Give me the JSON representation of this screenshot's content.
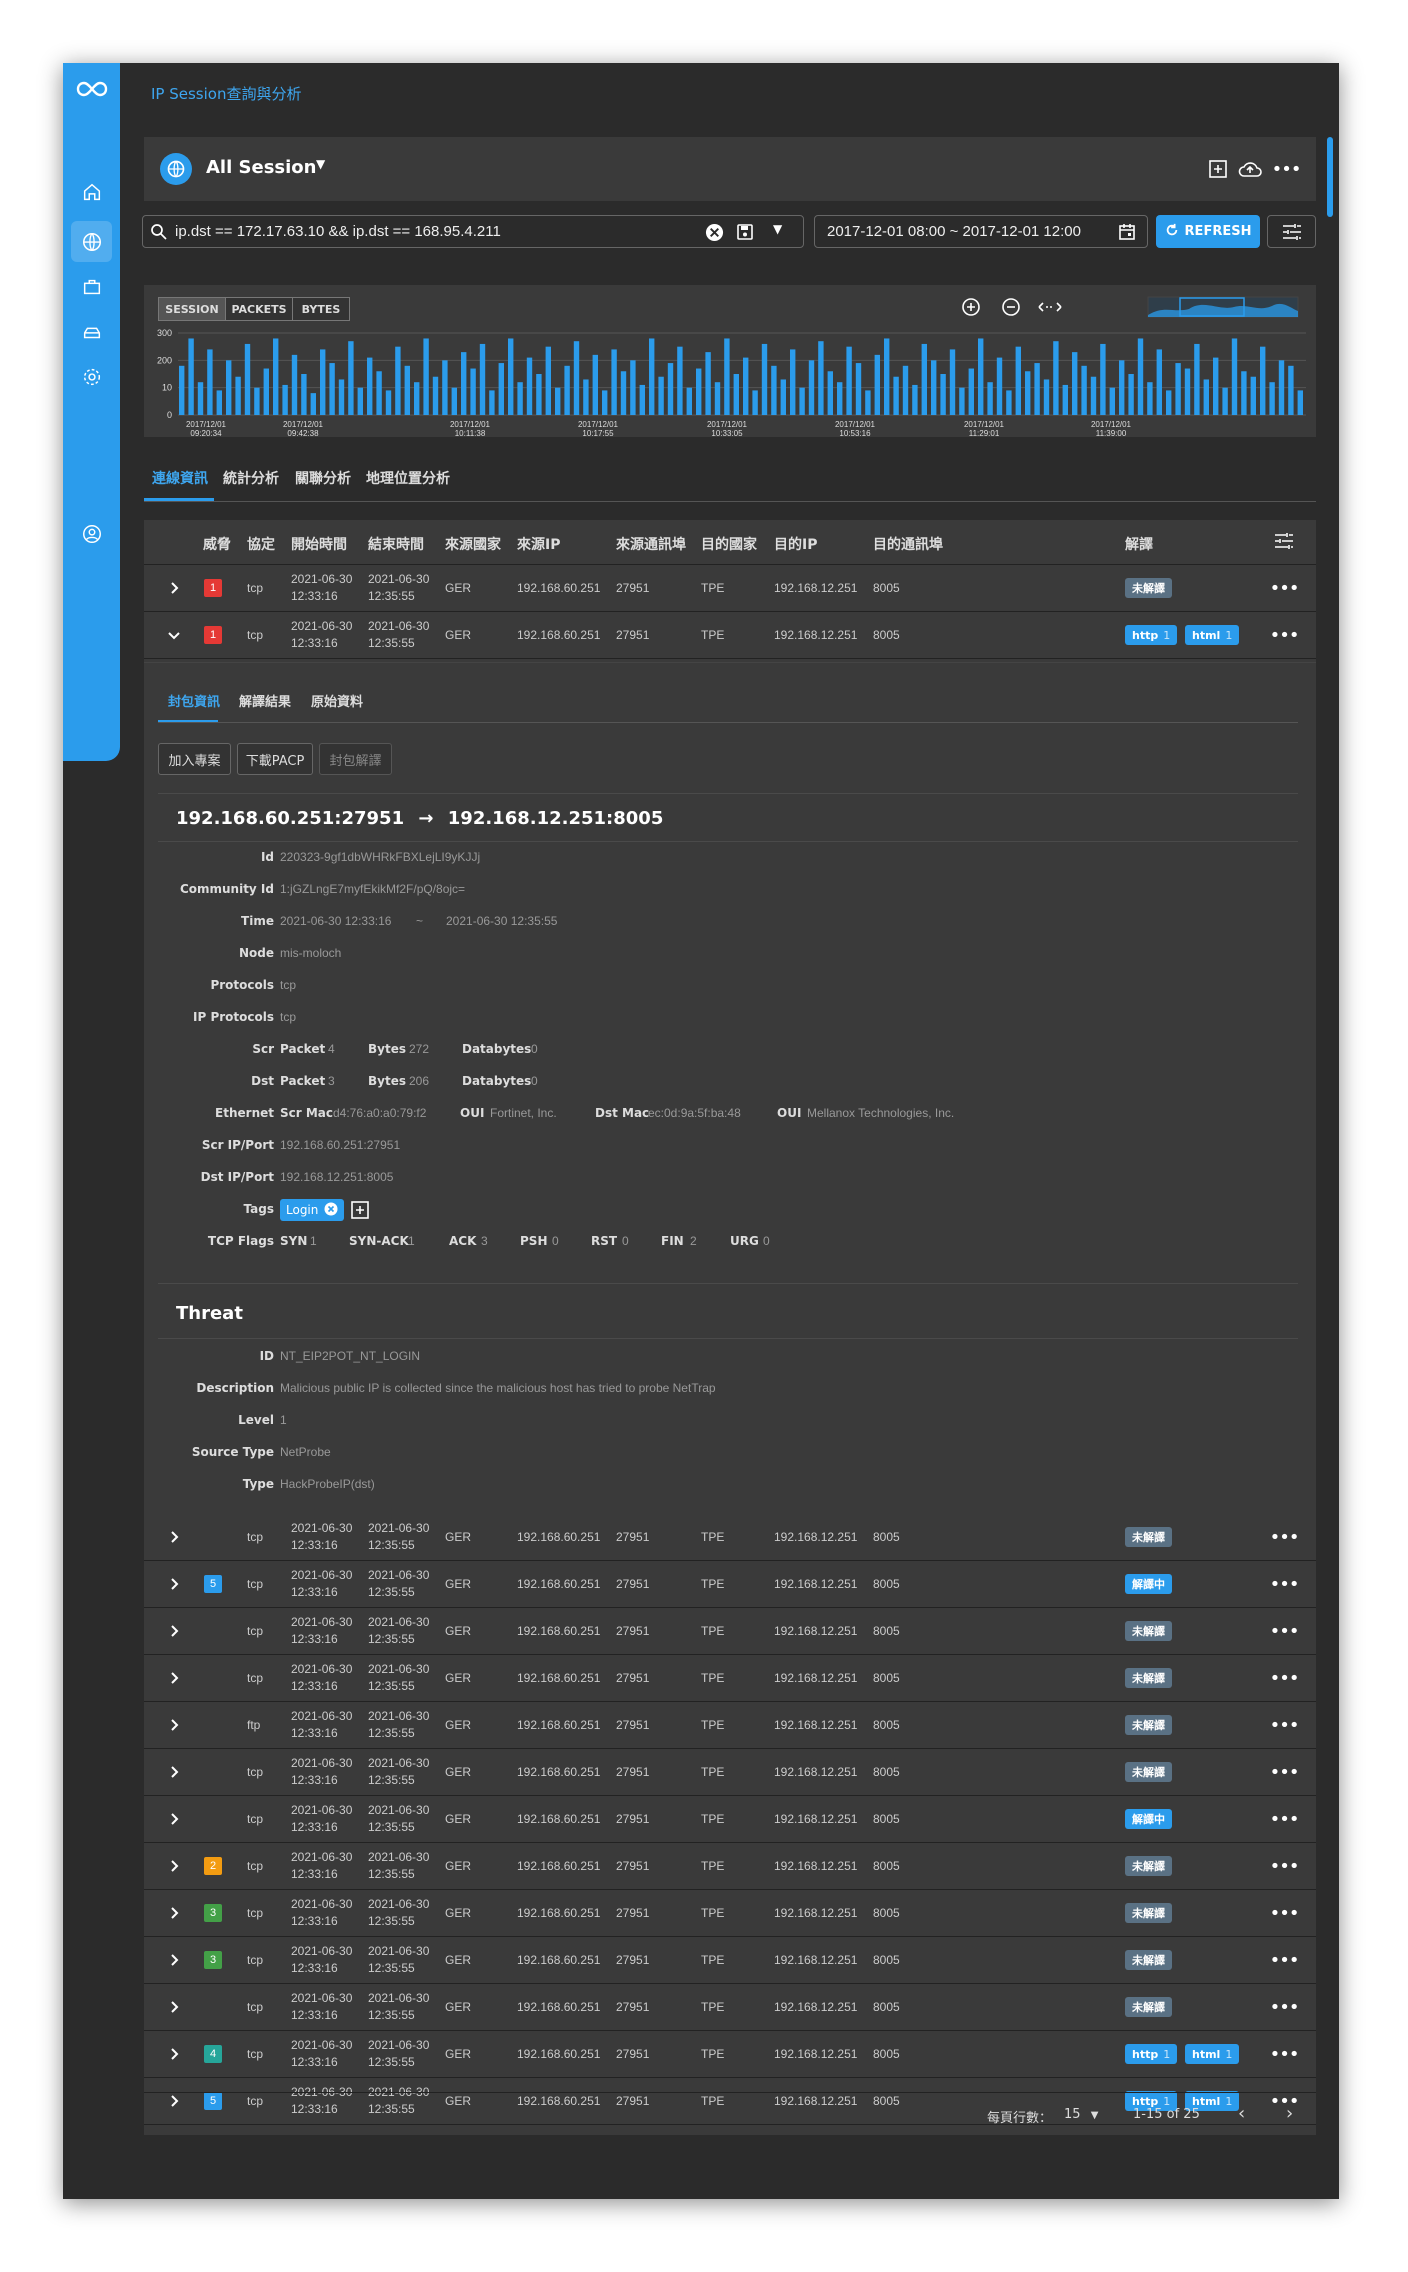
{
  "breadcrumb": "IP Session查詢與分析",
  "toolbar": {
    "title": "All Session"
  },
  "search": {
    "query": "ip.dst == 172.17.63.10 && ip.dst == 168.95.4.211"
  },
  "daterange": {
    "value": "2017-12-01 08:00 ~ 2017-12-01 12:00"
  },
  "refresh_label": "REFRESH",
  "chart_data": {
    "type": "bar",
    "toggles": [
      "SESSION",
      "PACKETS",
      "BYTES"
    ],
    "active_toggle": "SESSION",
    "yticks": [
      "300",
      "200",
      "10",
      "0"
    ],
    "xticks": [
      {
        "date": "2017/12/01",
        "time": "09:20:34"
      },
      {
        "date": "2017/12/01",
        "time": "09:42:38"
      },
      {
        "date": "2017/12/01",
        "time": "10:11:38"
      },
      {
        "date": "2017/12/01",
        "time": "10:17:55"
      },
      {
        "date": "2017/12/01",
        "time": "10:33:05"
      },
      {
        "date": "2017/12/01",
        "time": "10:53:16"
      },
      {
        "date": "2017/12/01",
        "time": "11:29:01"
      },
      {
        "date": "2017/12/01",
        "time": "11:39:00"
      }
    ],
    "values": [
      180,
      280,
      120,
      240,
      90,
      200,
      140,
      260,
      100,
      170,
      280,
      110,
      220,
      150,
      80,
      240,
      190,
      130,
      270,
      100,
      210,
      160,
      90,
      250,
      180,
      120,
      280,
      140,
      200,
      100,
      230,
      170,
      260,
      90,
      190,
      280,
      120,
      210,
      150,
      250,
      100,
      180,
      270,
      130,
      220,
      90,
      240,
      160,
      200,
      110,
      280,
      140,
      190,
      250,
      100,
      170,
      230,
      120,
      280,
      150,
      210,
      90,
      260,
      180,
      130,
      240,
      100,
      200,
      270,
      160,
      120,
      250,
      190,
      90,
      220,
      280,
      140,
      180,
      110,
      260,
      200,
      150,
      240,
      100,
      170,
      280,
      120,
      210,
      90,
      250,
      160,
      190,
      130,
      270,
      110,
      230,
      180,
      140,
      260,
      100,
      200,
      150,
      280,
      120,
      240,
      90,
      190,
      170,
      260,
      130,
      210,
      100,
      280,
      160,
      140,
      250,
      120,
      200,
      180,
      90
    ]
  },
  "tabs": [
    "連線資訊",
    "統計分析",
    "關聯分析",
    "地理位置分析"
  ],
  "columns": [
    "威脅",
    "協定",
    "開始時間",
    "結束時間",
    "來源國家",
    "來源IP",
    "來源通訊埠",
    "目的國家",
    "目的IP",
    "目的通訊埠",
    "解譯"
  ],
  "rows": [
    {
      "threat": "1",
      "threat_color": "#e53935",
      "proto": "tcp",
      "start_date": "2021-06-30",
      "start_time": "12:33:16",
      "end_date": "2021-06-30",
      "end_time": "12:35:55",
      "src_country": "GER",
      "src_ip": "192.168.60.251",
      "src_port": "27951",
      "dst_country": "TPE",
      "dst_ip": "192.168.12.251",
      "dst_port": "8005",
      "badges": [
        {
          "label": "未解譯",
          "type": "gray"
        }
      ]
    },
    {
      "threat": "1",
      "threat_color": "#e53935",
      "proto": "tcp",
      "start_date": "2021-06-30",
      "start_time": "12:33:16",
      "end_date": "2021-06-30",
      "end_time": "12:35:55",
      "src_country": "GER",
      "src_ip": "192.168.60.251",
      "src_port": "27951",
      "dst_country": "TPE",
      "dst_ip": "192.168.12.251",
      "dst_port": "8005",
      "badges": [
        {
          "label": "http",
          "count": "1",
          "type": "blue"
        },
        {
          "label": "html",
          "count": "1",
          "type": "blue"
        }
      ]
    },
    {
      "threat": "",
      "threat_color": "",
      "proto": "tcp",
      "start_date": "2021-06-30",
      "start_time": "12:33:16",
      "end_date": "2021-06-30",
      "end_time": "12:35:55",
      "src_country": "GER",
      "src_ip": "192.168.60.251",
      "src_port": "27951",
      "dst_country": "TPE",
      "dst_ip": "192.168.12.251",
      "dst_port": "8005",
      "badges": [
        {
          "label": "未解譯",
          "type": "gray"
        }
      ]
    },
    {
      "threat": "5",
      "threat_color": "#2b9cec",
      "proto": "tcp",
      "start_date": "2021-06-30",
      "start_time": "12:33:16",
      "end_date": "2021-06-30",
      "end_time": "12:35:55",
      "src_country": "GER",
      "src_ip": "192.168.60.251",
      "src_port": "27951",
      "dst_country": "TPE",
      "dst_ip": "192.168.12.251",
      "dst_port": "8005",
      "badges": [
        {
          "label": "解譯中",
          "type": "blue"
        }
      ]
    },
    {
      "threat": "",
      "threat_color": "",
      "proto": "tcp",
      "start_date": "2021-06-30",
      "start_time": "12:33:16",
      "end_date": "2021-06-30",
      "end_time": "12:35:55",
      "src_country": "GER",
      "src_ip": "192.168.60.251",
      "src_port": "27951",
      "dst_country": "TPE",
      "dst_ip": "192.168.12.251",
      "dst_port": "8005",
      "badges": [
        {
          "label": "未解譯",
          "type": "gray"
        }
      ]
    },
    {
      "threat": "",
      "threat_color": "",
      "proto": "tcp",
      "start_date": "2021-06-30",
      "start_time": "12:33:16",
      "end_date": "2021-06-30",
      "end_time": "12:35:55",
      "src_country": "GER",
      "src_ip": "192.168.60.251",
      "src_port": "27951",
      "dst_country": "TPE",
      "dst_ip": "192.168.12.251",
      "dst_port": "8005",
      "badges": [
        {
          "label": "未解譯",
          "type": "gray"
        }
      ]
    },
    {
      "threat": "",
      "threat_color": "",
      "proto": "ftp",
      "start_date": "2021-06-30",
      "start_time": "12:33:16",
      "end_date": "2021-06-30",
      "end_time": "12:35:55",
      "src_country": "GER",
      "src_ip": "192.168.60.251",
      "src_port": "27951",
      "dst_country": "TPE",
      "dst_ip": "192.168.12.251",
      "dst_port": "8005",
      "badges": [
        {
          "label": "未解譯",
          "type": "gray"
        }
      ]
    },
    {
      "threat": "",
      "threat_color": "",
      "proto": "tcp",
      "start_date": "2021-06-30",
      "start_time": "12:33:16",
      "end_date": "2021-06-30",
      "end_time": "12:35:55",
      "src_country": "GER",
      "src_ip": "192.168.60.251",
      "src_port": "27951",
      "dst_country": "TPE",
      "dst_ip": "192.168.12.251",
      "dst_port": "8005",
      "badges": [
        {
          "label": "未解譯",
          "type": "gray"
        }
      ]
    },
    {
      "threat": "",
      "threat_color": "",
      "proto": "tcp",
      "start_date": "2021-06-30",
      "start_time": "12:33:16",
      "end_date": "2021-06-30",
      "end_time": "12:35:55",
      "src_country": "GER",
      "src_ip": "192.168.60.251",
      "src_port": "27951",
      "dst_country": "TPE",
      "dst_ip": "192.168.12.251",
      "dst_port": "8005",
      "badges": [
        {
          "label": "解譯中",
          "type": "blue"
        }
      ]
    },
    {
      "threat": "2",
      "threat_color": "#f39c12",
      "proto": "tcp",
      "start_date": "2021-06-30",
      "start_time": "12:33:16",
      "end_date": "2021-06-30",
      "end_time": "12:35:55",
      "src_country": "GER",
      "src_ip": "192.168.60.251",
      "src_port": "27951",
      "dst_country": "TPE",
      "dst_ip": "192.168.12.251",
      "dst_port": "8005",
      "badges": [
        {
          "label": "未解譯",
          "type": "gray"
        }
      ]
    },
    {
      "threat": "3",
      "threat_color": "#43a047",
      "proto": "tcp",
      "start_date": "2021-06-30",
      "start_time": "12:33:16",
      "end_date": "2021-06-30",
      "end_time": "12:35:55",
      "src_country": "GER",
      "src_ip": "192.168.60.251",
      "src_port": "27951",
      "dst_country": "TPE",
      "dst_ip": "192.168.12.251",
      "dst_port": "8005",
      "badges": [
        {
          "label": "未解譯",
          "type": "gray"
        }
      ]
    },
    {
      "threat": "3",
      "threat_color": "#43a047",
      "proto": "tcp",
      "start_date": "2021-06-30",
      "start_time": "12:33:16",
      "end_date": "2021-06-30",
      "end_time": "12:35:55",
      "src_country": "GER",
      "src_ip": "192.168.60.251",
      "src_port": "27951",
      "dst_country": "TPE",
      "dst_ip": "192.168.12.251",
      "dst_port": "8005",
      "badges": [
        {
          "label": "未解譯",
          "type": "gray"
        }
      ]
    },
    {
      "threat": "",
      "threat_color": "",
      "proto": "tcp",
      "start_date": "2021-06-30",
      "start_time": "12:33:16",
      "end_date": "2021-06-30",
      "end_time": "12:35:55",
      "src_country": "GER",
      "src_ip": "192.168.60.251",
      "src_port": "27951",
      "dst_country": "TPE",
      "dst_ip": "192.168.12.251",
      "dst_port": "8005",
      "badges": [
        {
          "label": "未解譯",
          "type": "gray"
        }
      ]
    },
    {
      "threat": "4",
      "threat_color": "#26a69a",
      "proto": "tcp",
      "start_date": "2021-06-30",
      "start_time": "12:33:16",
      "end_date": "2021-06-30",
      "end_time": "12:35:55",
      "src_country": "GER",
      "src_ip": "192.168.60.251",
      "src_port": "27951",
      "dst_country": "TPE",
      "dst_ip": "192.168.12.251",
      "dst_port": "8005",
      "badges": [
        {
          "label": "http",
          "count": "1",
          "type": "blue"
        },
        {
          "label": "html",
          "count": "1",
          "type": "blue"
        }
      ]
    },
    {
      "threat": "5",
      "threat_color": "#2b9cec",
      "proto": "tcp",
      "start_date": "2021-06-30",
      "start_time": "12:33:16",
      "end_date": "2021-06-30",
      "end_time": "12:35:55",
      "src_country": "GER",
      "src_ip": "192.168.60.251",
      "src_port": "27951",
      "dst_country": "TPE",
      "dst_ip": "192.168.12.251",
      "dst_port": "8005",
      "badges": [
        {
          "label": "http",
          "count": "1",
          "type": "blue"
        },
        {
          "label": "html",
          "count": "1",
          "type": "blue"
        }
      ]
    }
  ],
  "detail": {
    "tabs": [
      "封包資訊",
      "解譯結果",
      "原始資料"
    ],
    "actions": [
      "加入專案",
      "下載PACP",
      "封包解譯"
    ],
    "flow_src": "192.168.60.251:27951",
    "flow_arrow": "→",
    "flow_dst": "192.168.12.251:8005",
    "id_label": "Id",
    "id": "220323-9gf1dbWHRkFBXLejLI9yKJJj",
    "community_label": "Community Id",
    "community_id": "1:jGZLngE7myfEkikMf2F/pQ/8ojc=",
    "time_label": "Time",
    "time_start": "2021-06-30 12:33:16",
    "time_sep": "~",
    "time_end": "2021-06-30 12:35:55",
    "node_label": "Node",
    "node": "mis-moloch",
    "protocols_label": "Protocols",
    "protocols": "tcp",
    "ip_protocols_label": "IP Protocols",
    "ip_protocols": "tcp",
    "scr_label": "Scr",
    "dst_label": "Dst",
    "packet_label": "Packet",
    "bytes_label": "Bytes",
    "databytes_label": "Databytes",
    "scr_packet": "4",
    "scr_bytes": "272",
    "scr_databytes": "0",
    "dst_packet": "3",
    "dst_bytes": "206",
    "dst_databytes": "0",
    "ethernet_label": "Ethernet",
    "scr_mac_label": "Scr Mac",
    "scr_mac": "d4:76:a0:a0:79:f2",
    "oui_label": "OUI",
    "scr_oui": "Fortinet, Inc.",
    "dst_mac_label": "Dst Mac",
    "dst_mac": "ec:0d:9a:5f:ba:48",
    "dst_oui": "Mellanox Technologies, Inc.",
    "scr_ipport_label": "Scr IP/Port",
    "scr_ipport": "192.168.60.251:27951",
    "dst_ipport_label": "Dst IP/Port",
    "dst_ipport": "192.168.12.251:8005",
    "tags_label": "Tags",
    "tag": "Login",
    "tcp_flags_label": "TCP Flags",
    "flags": [
      {
        "name": "SYN",
        "value": "1"
      },
      {
        "name": "SYN-ACK",
        "value": "1"
      },
      {
        "name": "ACK",
        "value": "3"
      },
      {
        "name": "PSH",
        "value": "0"
      },
      {
        "name": "RST",
        "value": "0"
      },
      {
        "name": "FIN",
        "value": "2"
      },
      {
        "name": "URG",
        "value": "0"
      }
    ],
    "threat_title": "Threat",
    "threat_id_label": "ID",
    "threat_id": "NT_EIP2POT_NT_LOGIN",
    "description_label": "Description",
    "description": "Malicious public IP is collected since the malicious host has tried to probe NetTrap",
    "level_label": "Level",
    "level": "1",
    "source_type_label": "Source Type",
    "source_type": "NetProbe",
    "type_label": "Type",
    "type": "HackProbeIP(dst)"
  },
  "pager": {
    "rows_label": "每頁行數：",
    "rows_value": "15",
    "range": "1-15 of 25"
  }
}
